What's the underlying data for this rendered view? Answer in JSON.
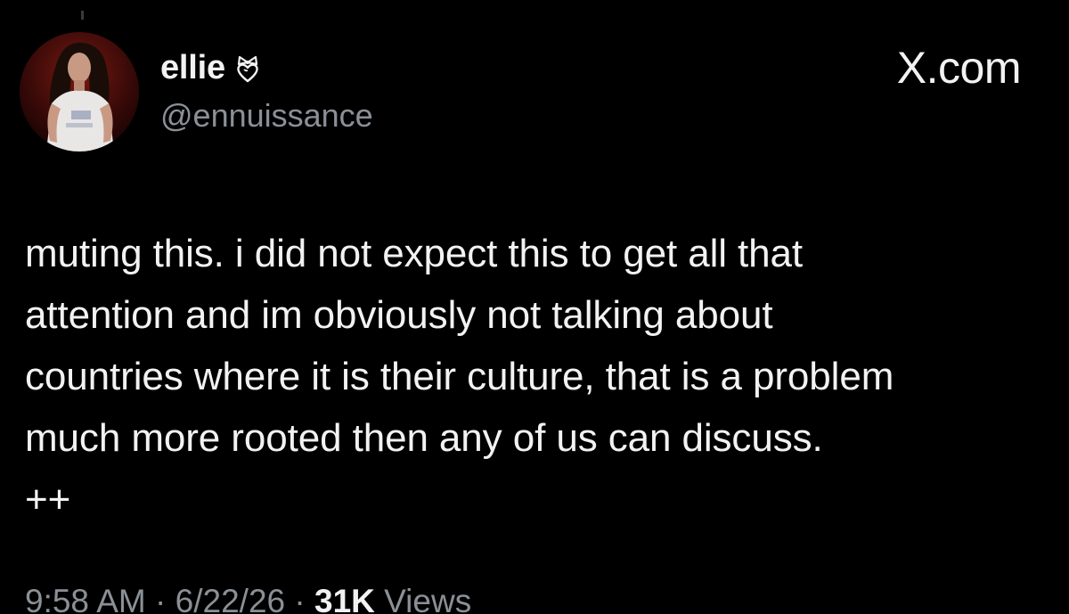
{
  "author": {
    "display_name": "ellie",
    "handle": "@ennuissance",
    "badge_icon": "heart-ribbon-icon"
  },
  "brand": "X.com",
  "tweet": {
    "lines": [
      "muting this. i did not expect this to get all that",
      "attention and im obviously not talking about",
      "countries where it is their culture, that is a problem",
      "much more rooted then any of us can discuss.",
      "++"
    ]
  },
  "meta": {
    "time": "9:58 AM",
    "separator": " · ",
    "date": "6/22/26",
    "views_count": "31K",
    "views_label": " Views"
  },
  "colors": {
    "background": "#000000",
    "text_primary": "#f2f2f2",
    "text_secondary": "#8b9096"
  }
}
